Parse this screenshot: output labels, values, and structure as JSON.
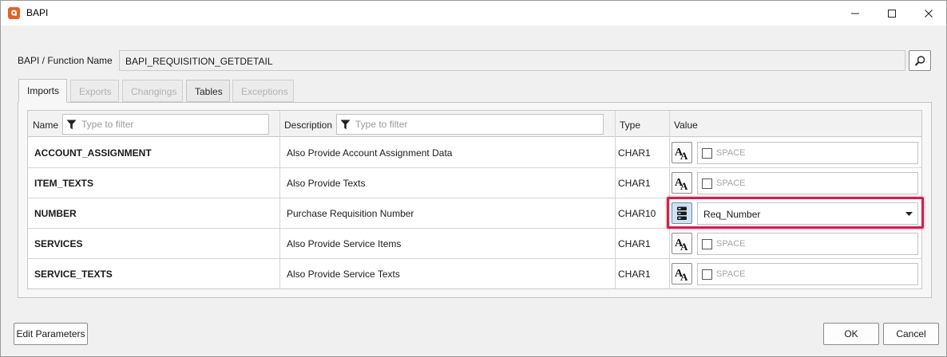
{
  "window": {
    "title": "BAPI"
  },
  "function": {
    "label": "BAPI / Function Name",
    "value": "BAPI_REQUISITION_GETDETAIL"
  },
  "tabs": [
    {
      "label": "Imports",
      "state": "active"
    },
    {
      "label": "Exports",
      "state": "disabled"
    },
    {
      "label": "Changings",
      "state": "disabled"
    },
    {
      "label": "Tables",
      "state": "enabled"
    },
    {
      "label": "Exceptions",
      "state": "disabled"
    }
  ],
  "grid": {
    "columns": {
      "name": "Name",
      "description": "Description",
      "type": "Type",
      "value": "Value"
    },
    "filter_placeholder": "Type to filter",
    "rows": [
      {
        "name": "ACCOUNT_ASSIGNMENT",
        "description": "Also Provide Account Assignment Data",
        "type": "CHAR1",
        "value_mode": "constant",
        "value": "SPACE",
        "checked": false
      },
      {
        "name": "ITEM_TEXTS",
        "description": "Also Provide Texts",
        "type": "CHAR1",
        "value_mode": "constant",
        "value": "SPACE",
        "checked": false
      },
      {
        "name": "NUMBER",
        "description": "Purchase Requisition Number",
        "type": "CHAR10",
        "value_mode": "parameter",
        "value": "Req_Number"
      },
      {
        "name": "SERVICES",
        "description": "Also Provide Service Items",
        "type": "CHAR1",
        "value_mode": "constant",
        "value": "SPACE",
        "checked": false
      },
      {
        "name": "SERVICE_TEXTS",
        "description": "Also Provide Service Texts",
        "type": "CHAR1",
        "value_mode": "constant",
        "value": "SPACE",
        "checked": false
      }
    ]
  },
  "buttons": {
    "edit_parameters": "Edit Parameters",
    "ok": "OK",
    "cancel": "Cancel"
  },
  "colors": {
    "app_logo": "#e2632a",
    "highlight": "#d21f4f"
  }
}
